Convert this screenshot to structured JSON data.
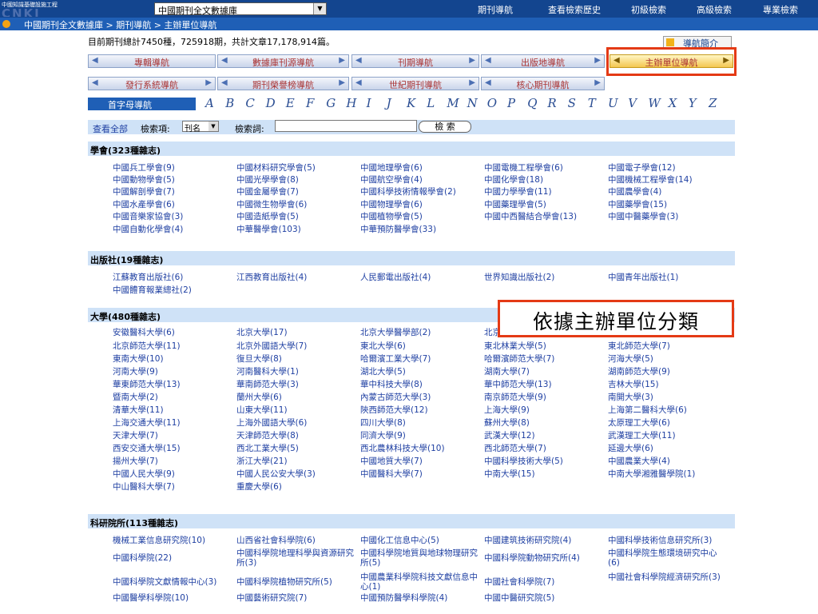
{
  "topbar": {
    "logo_small": "中國知識基礎設施工程",
    "logo_big": "CNKI",
    "db_select": "中國期刊全文數據庫",
    "nav": [
      "期刊導航",
      "查看檢索歷史",
      "初級檢索",
      "高級檢索",
      "專業檢索"
    ]
  },
  "breadcrumb": "中國期刊全文數據庫 > 期刊導航 > 主辦單位導航",
  "summary": "目前期刊總計7450種，725918期，共計文章17,178,914篇。",
  "intro_button": "導航簡介",
  "tabs_row1": [
    "專輯導航",
    "數據庫刊源導航",
    "刊期導航",
    "出版地導航",
    "主辦單位導航"
  ],
  "tabs_row2": [
    "發行系統導航",
    "期刊榮譽榜導航",
    "世紀期刊導航",
    "核心期刊導航"
  ],
  "alpha": {
    "label": "首字母導航",
    "letters": [
      "A",
      "B",
      "C",
      "D",
      "E",
      "F",
      "G",
      "H",
      "I",
      "J",
      "K",
      "L",
      "M",
      "N",
      "O",
      "P",
      "Q",
      "R",
      "S",
      "T",
      "U",
      "V",
      "W",
      "X",
      "Y",
      "Z"
    ]
  },
  "search": {
    "view_all": "查看全部",
    "field_label": "檢索項:",
    "field_value": "刊名",
    "term_label": "檢索詞:",
    "button": "檢 索"
  },
  "sections": [
    {
      "title": "學會(323種雜志)",
      "items": [
        "中國兵工學會(9)",
        "中國材料研究學會(5)",
        "中國地理學會(6)",
        "中國電機工程學會(6)",
        "中國電子學會(12)",
        "中國動物學會(5)",
        "中國光學學會(8)",
        "中國航空學會(4)",
        "中國化學會(18)",
        "中國機械工程學會(14)",
        "中國解剖學會(7)",
        "中國金屬學會(7)",
        "中國科學技術情報學會(2)",
        "中國力學學會(11)",
        "中國農學會(4)",
        "中國水產學會(6)",
        "中國微生物學會(6)",
        "中國物理學會(6)",
        "中國藥理學會(5)",
        "中國藥學會(15)",
        "中國音樂家協會(3)",
        "中國造紙學會(5)",
        "中國植物學會(5)",
        "中國中西醫結合學會(13)",
        "中國中醫藥學會(3)",
        "中國自動化學會(4)",
        "中華醫學會(103)",
        "中華預防醫學會(33)"
      ]
    },
    {
      "title": "出版社(19種雜志)",
      "items": [
        "江蘇教育出版社(6)",
        "江西教育出版社(4)",
        "人民郵電出版社(4)",
        "世界知識出版社(2)",
        "中國青年出版社(1)",
        "中國體育報業總社(2)"
      ]
    },
    {
      "title": "大學(480種雜志)",
      "items": [
        "安徽醫科大學(6)",
        "北京大學(17)",
        "北京大學醫學部(2)",
        "北京",
        "",
        "北京師范大學(11)",
        "北京外國語大學(7)",
        "東北大學(6)",
        "東北林業大學(5)",
        "東北師范大學(7)",
        "東南大學(10)",
        "復旦大學(8)",
        "哈爾濱工業大學(7)",
        "哈爾濱師范大學(7)",
        "河海大學(5)",
        "河南大學(9)",
        "河南醫科大學(1)",
        "湖北大學(5)",
        "湖南大學(7)",
        "湖南師范大學(9)",
        "華東師范大學(13)",
        "華南師范大學(3)",
        "華中科技大學(8)",
        "華中師范大學(13)",
        "吉林大學(15)",
        "暨南大學(2)",
        "蘭州大學(6)",
        "內蒙古師范大學(3)",
        "南京師范大學(9)",
        "南開大學(3)",
        "清華大學(11)",
        "山東大學(11)",
        "陝西師范大學(12)",
        "上海大學(9)",
        "上海第二醫科大學(6)",
        "上海交通大學(11)",
        "上海外國語大學(6)",
        "四川大學(8)",
        "蘇州大學(8)",
        "太原理工大學(6)",
        "天津大學(7)",
        "天津師范大學(8)",
        "同濟大學(9)",
        "武漢大學(12)",
        "武漢理工大學(11)",
        "西安交通大學(15)",
        "西北工業大學(5)",
        "西北農林科技大學(10)",
        "西北師范大學(7)",
        "延邊大學(6)",
        "揚州大學(7)",
        "浙江大學(21)",
        "中國地質大學(7)",
        "中國科學技術大學(5)",
        "中國農業大學(4)",
        "中國人民大學(9)",
        "中國人民公安大學(3)",
        "中國醫科大學(7)",
        "中南大學(15)",
        "中南大學湘雅醫學院(1)",
        "中山醫科大學(7)",
        "重慶大學(6)"
      ]
    },
    {
      "title": "科研院所(113種雜志)",
      "items": [
        "機械工業信息研究院(10)",
        "山西省社會科學院(6)",
        "中國化工信息中心(5)",
        "中國建筑技術研究院(4)",
        "中國科學技術信息研究所(3)",
        "中國科學院(22)",
        "中國科學院地理科學與資源研究所(3)",
        "中國科學院地質與地球物理研究所(5)",
        "中國科學院動物研究所(4)",
        "中國科學院生態環境研究中心(6)",
        "中國科學院文獻情報中心(3)",
        "中國科學院植物研究所(5)",
        "中國農業科學院科技文獻信息中心(1)",
        "中國社會科學院(7)",
        "中國社會科學院經濟研究所(3)",
        "中國醫學科學院(10)",
        "中國藝術研究院(7)",
        "中國預防醫學科學院(4)",
        "中國中醫研究院(5)",
        ""
      ]
    }
  ],
  "callout": "依據主辦單位分類",
  "colors": {
    "topbar": "#13458f",
    "crumbbar": "#1f5fb6",
    "section_bg": "#cfe2f7",
    "link": "#1e3fa2",
    "highlight": "#e43a15"
  }
}
